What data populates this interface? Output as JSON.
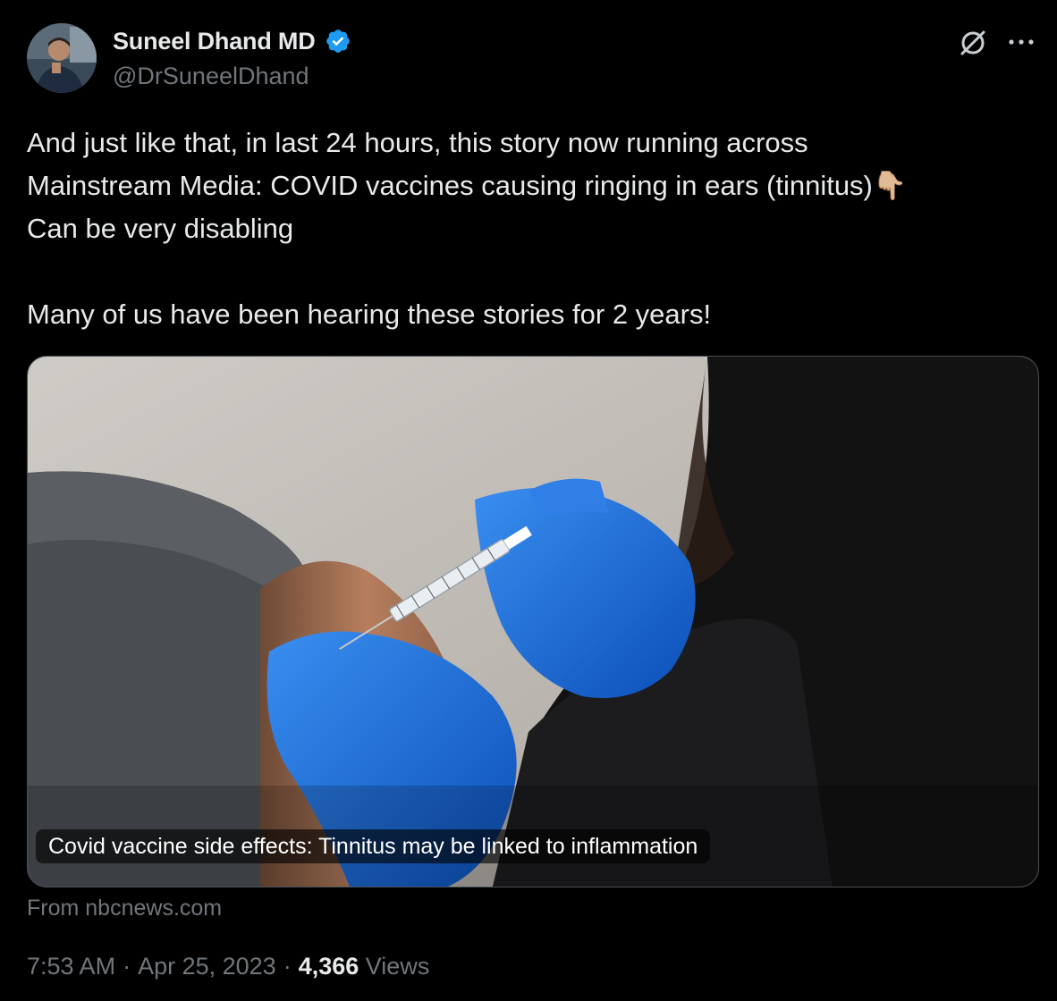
{
  "author": {
    "display_name": "Suneel Dhand MD",
    "handle": "@DrSuneelDhand",
    "verified_icon": "verified-badge-icon"
  },
  "actions": {
    "grok_icon": "grok-icon",
    "more_icon": "more-options-icon"
  },
  "tweet": {
    "text": "And just like that, in last 24 hours, this story now running across\nMainstream Media: COVID vaccines causing ringing in ears (tinnitus)👇🏼\nCan be very disabling\n\nMany of us have been hearing these stories for 2 years!"
  },
  "card": {
    "title": "Covid vaccine side effects: Tinnitus may be linked to inflammation",
    "source": "From nbcnews.com"
  },
  "meta": {
    "time": "7:53 AM",
    "separator1": "·",
    "date": "Apr 25, 2023",
    "separator2": "·",
    "views_count": "4,366",
    "views_label": "Views"
  },
  "colors": {
    "background": "#000000",
    "text_primary": "#e7e9ea",
    "text_secondary": "#71767b",
    "verified_blue": "#1d9bf0"
  }
}
